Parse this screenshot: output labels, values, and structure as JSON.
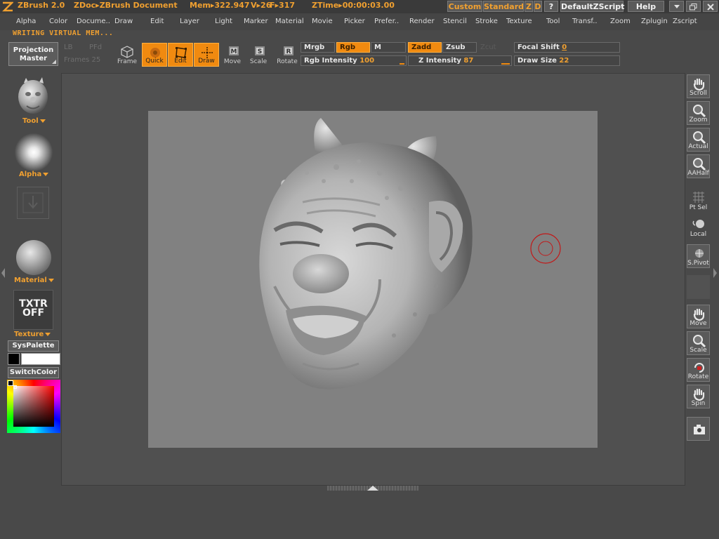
{
  "titlebar": {
    "app_name": "ZBrush 2.0",
    "doc": "ZDoc▸ZBrush Document",
    "mem": "Mem▸322.947",
    "verts": "V▸26",
    "faces": "F▸317",
    "ztime": "ZTime▸00:00:03.00",
    "custom": "Custom",
    "standard": "Standard",
    "z": "Z",
    "d": "D",
    "q": "?",
    "script": "DefaultZScript",
    "help": "Help"
  },
  "menu": [
    "Alpha",
    "Color",
    "Docume..",
    "Draw",
    "Edit",
    "Layer",
    "Light",
    "Marker",
    "Material",
    "Movie",
    "Picker",
    "Prefer..",
    "Render",
    "Stencil",
    "Stroke",
    "Texture",
    "Tool",
    "Transf..",
    "Zoom",
    "Zplugin",
    "Zscript"
  ],
  "status": "WRITING VIRTUAL MEM...",
  "toolbar": {
    "projection_master_1": "Projection",
    "projection_master_2": "Master",
    "lightbox": "LB",
    "pfd": "PFd",
    "frames": "Frames 25",
    "frame": "Frame",
    "quick": "Quick",
    "edit": "Edit",
    "draw": "Draw",
    "move": "Move",
    "scale": "Scale",
    "rotate": "Rotate",
    "mrgb": "Mrgb",
    "rgb": "Rgb",
    "m": "M",
    "zadd": "Zadd",
    "zsub": "Zsub",
    "zcut": "Zcut",
    "rgb_intensity_label": "Rgb  Intensity",
    "rgb_intensity_value": "100",
    "z_intensity_label": "Z  Intensity",
    "z_intensity_value": "87",
    "focal_shift_label": "Focal  Shift",
    "focal_shift_value": "0",
    "draw_size_label": "Draw  Size",
    "draw_size_value": "22"
  },
  "leftshelf": {
    "tool": "Tool",
    "alpha": "Alpha",
    "material": "Material",
    "texture_1": "TXTR",
    "texture_2": "OFF",
    "texture": "Texture",
    "syspalette": "SysPalette",
    "switchcolor": "SwitchColor"
  },
  "rightshelf": {
    "scroll": "Scroll",
    "zoom": "Zoom",
    "actual": "Actual",
    "aahalf": "AAHalf",
    "ptsel": "Pt Sel",
    "local": "Local",
    "spivot": "S.Pivot",
    "move": "Move",
    "scale": "Scale",
    "rotate": "Rotate",
    "spin": "Spin"
  },
  "colors": {
    "accent": "#f08a10",
    "main_color": "#000000",
    "secondary_color": "#ffffff"
  },
  "icons": [
    "zbrush-logo-icon",
    "cube-icon",
    "quick-icon",
    "edit-icon",
    "draw-icon",
    "move-icon",
    "scale-icon",
    "rotate-icon",
    "hand-icon",
    "magnifier-icon",
    "sphere-icon",
    "camera-icon",
    "brush-cursor-icon"
  ]
}
